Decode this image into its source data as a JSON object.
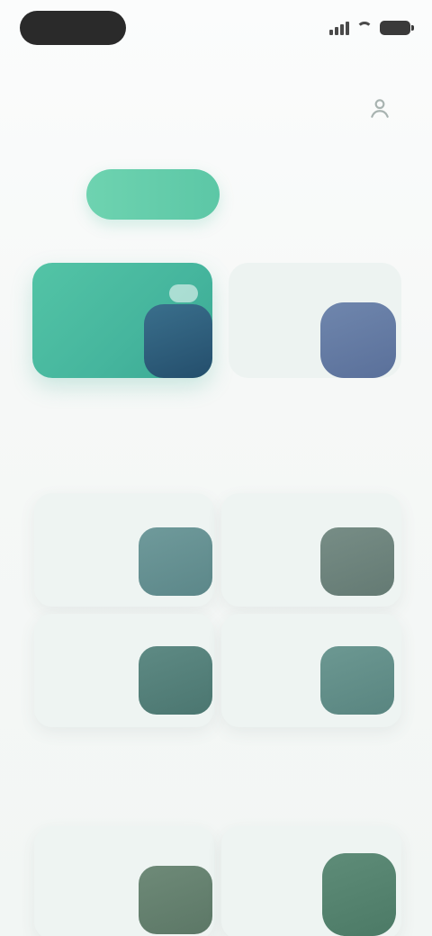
{
  "status_bar": {
    "time": "",
    "icons": [
      "signal-icon",
      "wifi-icon",
      "battery-icon"
    ]
  },
  "header": {
    "action_icon": "user-icon"
  },
  "tabs": [
    {
      "label": "",
      "active": true
    },
    {
      "label": "",
      "active": false
    }
  ],
  "hero": [
    {
      "title": "",
      "subtitle": ""
    },
    {
      "title": "",
      "subtitle": ""
    }
  ],
  "sections": [
    {
      "title": "",
      "cards": [
        {
          "label": ""
        },
        {
          "label": ""
        },
        {
          "label": ""
        },
        {
          "label": ""
        }
      ]
    },
    {
      "title": "",
      "cards": [
        {
          "label": ""
        },
        {
          "label": ""
        }
      ]
    }
  ],
  "colors": {
    "accent": "#5cc7a6",
    "accent_dark": "#3aa893",
    "background": "#f4f7f6",
    "card": "#eef4f2"
  }
}
